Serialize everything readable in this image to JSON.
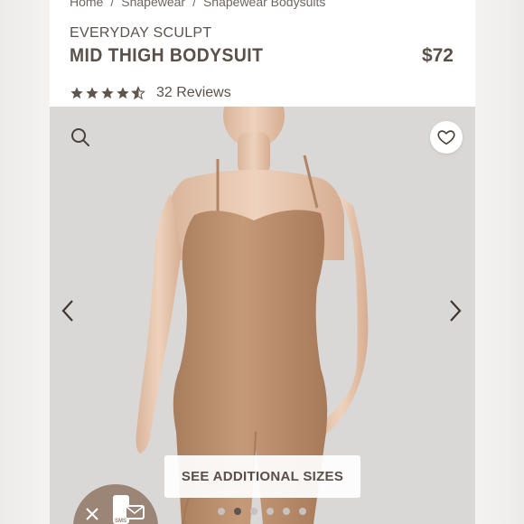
{
  "breadcrumb": {
    "items": [
      "Home",
      "Shapewear",
      "Shapewear Bodysuits"
    ],
    "separator": "/"
  },
  "product": {
    "collection": "EVERYDAY SCULPT",
    "name": "MID THIGH BODYSUIT",
    "price": "$72",
    "rating": 4.5,
    "reviews": "32 Reviews"
  },
  "gallery": {
    "sizes_button_label": "SEE ADDITIONAL SIZES",
    "image_count": 6,
    "active_index": 1
  },
  "sms_widget": {
    "label": "SMS"
  },
  "colors": {
    "text": "#5a4f49",
    "star": "#5f5550",
    "skin_tone_garment": "#b98e6c",
    "widget": "#9a8576"
  },
  "icons": [
    "search-icon",
    "heart-icon",
    "chevron-left-icon",
    "chevron-right-icon",
    "close-icon",
    "sms-phone-icon"
  ]
}
